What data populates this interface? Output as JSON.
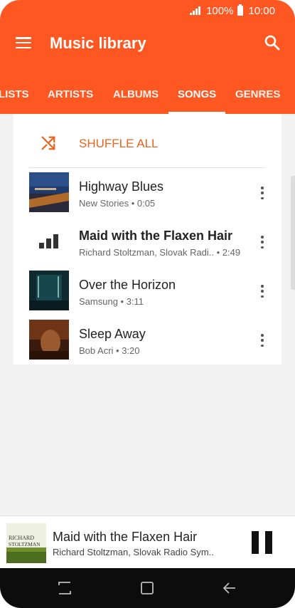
{
  "status_bar": {
    "battery": "100%",
    "time": "10:00"
  },
  "app_bar": {
    "title": "Music library",
    "menu_icon": "menu-icon",
    "search_icon": "search-icon"
  },
  "tabs": [
    {
      "label": "LISTS"
    },
    {
      "label": "ARTISTS"
    },
    {
      "label": "ALBUMS"
    },
    {
      "label": "SONGS",
      "active": true
    },
    {
      "label": "GENRES"
    }
  ],
  "shuffle": {
    "label": "SHUFFLE ALL",
    "icon": "shuffle-icon"
  },
  "songs": [
    {
      "title": "Highway Blues",
      "meta": "New Stories • 0:05",
      "playing": false
    },
    {
      "title": "Maid with the Flaxen Hair",
      "meta": "Richard Stoltzman, Slovak Radi..  • 2:49",
      "playing": true
    },
    {
      "title": "Over the Horizon",
      "meta": "Samsung • 3:11",
      "playing": false
    },
    {
      "title": "Sleep Away",
      "meta": "Bob Acri • 3:20",
      "playing": false
    }
  ],
  "mini_player": {
    "title": "Maid with the Flaxen Hair",
    "artist": "Richard Stoltzman, Slovak Radio Sym..",
    "art_text_line1": "RICHARD",
    "art_text_line2": "STOLTZMAN",
    "control": "pause-icon"
  },
  "nav_bar": {
    "icons": [
      "recents-icon",
      "home-icon",
      "back-icon"
    ]
  },
  "colors": {
    "accent": "#ff5722",
    "shuffle_text": "#e8641e"
  }
}
